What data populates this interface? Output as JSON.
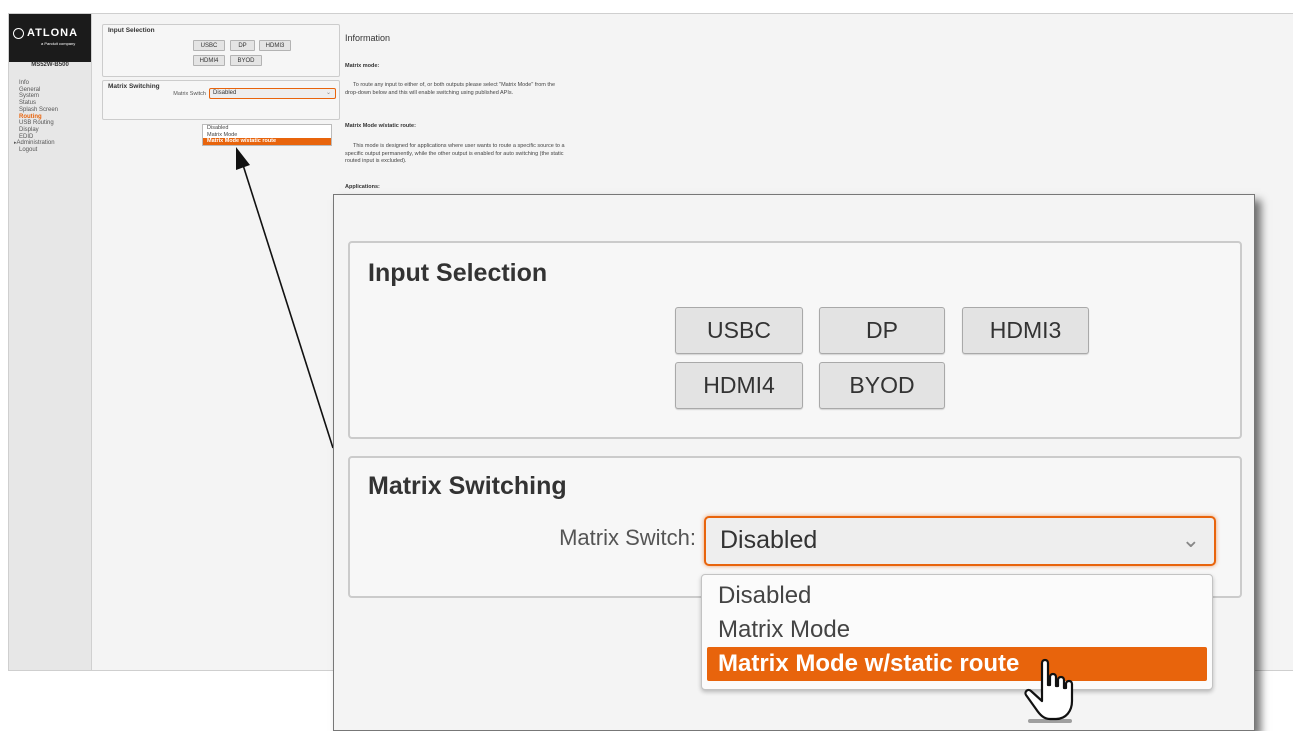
{
  "brand": {
    "name": "ATLONA",
    "tagline": "a Panduit company"
  },
  "device_model": "MS52W-B500",
  "nav": {
    "items": [
      "Info",
      "General",
      "System",
      "Status",
      "Splash Screen",
      "Routing",
      "USB Routing",
      "Display",
      "EDID",
      "Administration",
      "Logout"
    ],
    "active": "Routing"
  },
  "input_selection": {
    "title": "Input Selection",
    "buttons": [
      "USBC",
      "DP",
      "HDMI3",
      "HDMI4",
      "BYOD"
    ]
  },
  "matrix_switching": {
    "title": "Matrix Switching",
    "label": "Matrix Switch:",
    "label_small": "Matrix Switch",
    "value": "Disabled",
    "options": [
      "Disabled",
      "Matrix Mode",
      "Matrix Mode w/static route"
    ],
    "highlighted_option": "Matrix Mode w/static route"
  },
  "information": {
    "title": "Information",
    "matrix_mode_heading": "Matrix mode:",
    "matrix_mode_text": "To route any input to either of, or both outputs please select \"Matrix Mode\" from the drop-down below and this will enable switching using published APIs.",
    "static_route_heading": "Matrix Mode w/static route:",
    "static_route_text": "This mode is designed for applications where user wants to route a specific source to a specific output permanently, while the other output is enabled for auto switching (the static routed input is excluded).",
    "applications_heading": "Applications:"
  },
  "colors": {
    "accent": "#e8640c",
    "sidebar": "#e7e7e7",
    "panel": "#f7f7f7"
  },
  "icons": [
    "atlona-logo-icon",
    "chevron-down-icon",
    "hand-pointer-icon",
    "callout-arrow-icon"
  ]
}
